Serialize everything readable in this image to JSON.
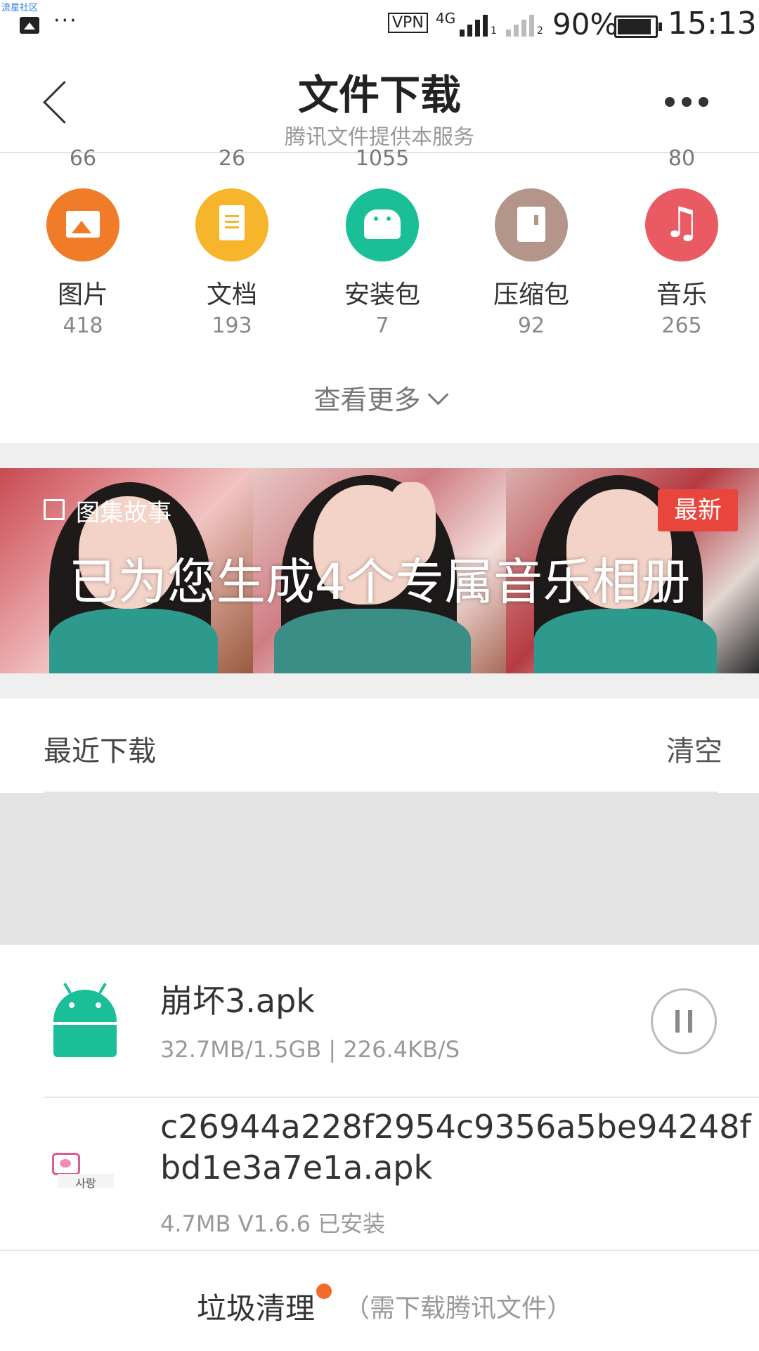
{
  "status_bar": {
    "watermark": "流星社区",
    "more": "···",
    "vpn": "VPN",
    "network": "4G",
    "sim1": "1",
    "sim2": "2",
    "battery_percent": "90%",
    "battery_level": 0.9,
    "time": "15:13"
  },
  "header": {
    "title": "文件下载",
    "subtitle": "腾讯文件提供本服务"
  },
  "top_counts": [
    "66",
    "26",
    "1055",
    "",
    "80"
  ],
  "categories": [
    {
      "label": "图片",
      "count": "418",
      "icon": "image-icon",
      "color": "#f07b28"
    },
    {
      "label": "文档",
      "count": "193",
      "icon": "document-icon",
      "color": "#f6b52a"
    },
    {
      "label": "安装包",
      "count": "7",
      "icon": "android-icon",
      "color": "#1bbf97"
    },
    {
      "label": "压缩包",
      "count": "92",
      "icon": "zip-icon",
      "color": "#b3958a"
    },
    {
      "label": "音乐",
      "count": "265",
      "icon": "music-icon",
      "color": "#ea5a63"
    }
  ],
  "view_more": "查看更多",
  "banner": {
    "tag": "图集故事",
    "badge": "最新",
    "headline": "已为您生成4个专属音乐相册"
  },
  "recent": {
    "title": "最近下载",
    "clear": "清空"
  },
  "downloads": [
    {
      "name": "崩坏3.apk",
      "meta": "32.7MB/1.5GB | 226.4KB/S",
      "icon": "android-icon",
      "state": "downloading"
    },
    {
      "name": "c26944a228f2954c9356a5be94248f",
      "name2": "bd1e3a7e1a.apk",
      "meta": "4.7MB  V1.6.6 已安装",
      "icon_text": "사랑",
      "icon": "app-icon"
    }
  ],
  "bottom": {
    "action": "垃圾清理",
    "note": "（需下载腾讯文件）"
  }
}
